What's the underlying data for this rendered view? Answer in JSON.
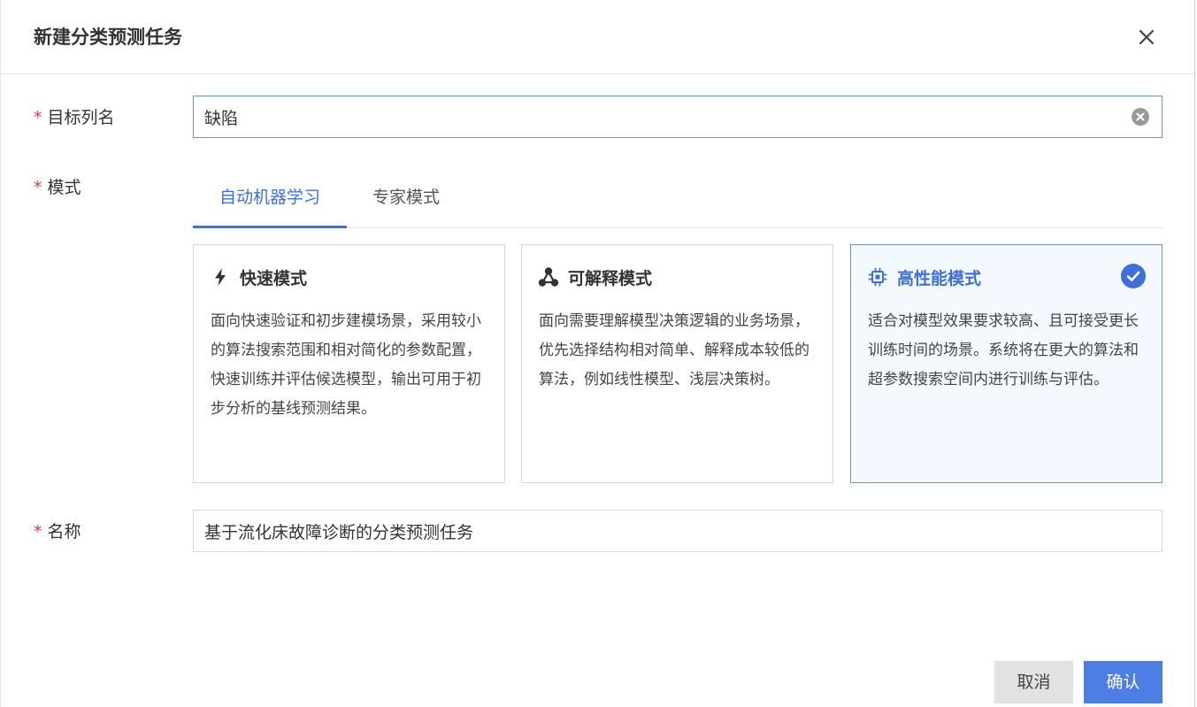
{
  "dialog": {
    "title": "新建分类预测任务"
  },
  "form": {
    "required_mark": "*",
    "target_label": "目标列名",
    "target_value": "缺陷",
    "mode_label": "模式",
    "name_label": "名称",
    "name_value": "基于流化床故障诊断的分类预测任务"
  },
  "tabs": [
    {
      "label": "自动机器学习",
      "active": true
    },
    {
      "label": "专家模式",
      "active": false
    }
  ],
  "cards": [
    {
      "title": "快速模式",
      "icon": "lightning-icon",
      "description": "面向快速验证和初步建模场景，采用较小的算法搜索范围和相对简化的参数配置，快速训练并评估候选模型，输出可用于初步分析的基线预测结果。",
      "selected": false
    },
    {
      "title": "可解释模式",
      "icon": "network-nodes-icon",
      "description": "面向需要理解模型决策逻辑的业务场景，优先选择结构相对简单、解释成本较低的算法，例如线性模型、浅层决策树。",
      "selected": false
    },
    {
      "title": "高性能模式",
      "icon": "chip-icon",
      "description": "适合对模型效果要求较高、且可接受更长训练时间的场景。系统将在更大的算法和超参数搜索空间内进行训练与评估。",
      "selected": true
    }
  ],
  "footer": {
    "cancel_label": "取消",
    "confirm_label": "确认"
  },
  "colors": {
    "accent": "#3f6fd8",
    "primary_button": "#4c7ee6",
    "required": "#e0403c",
    "selected_card_bg": "#f4f8ff"
  }
}
